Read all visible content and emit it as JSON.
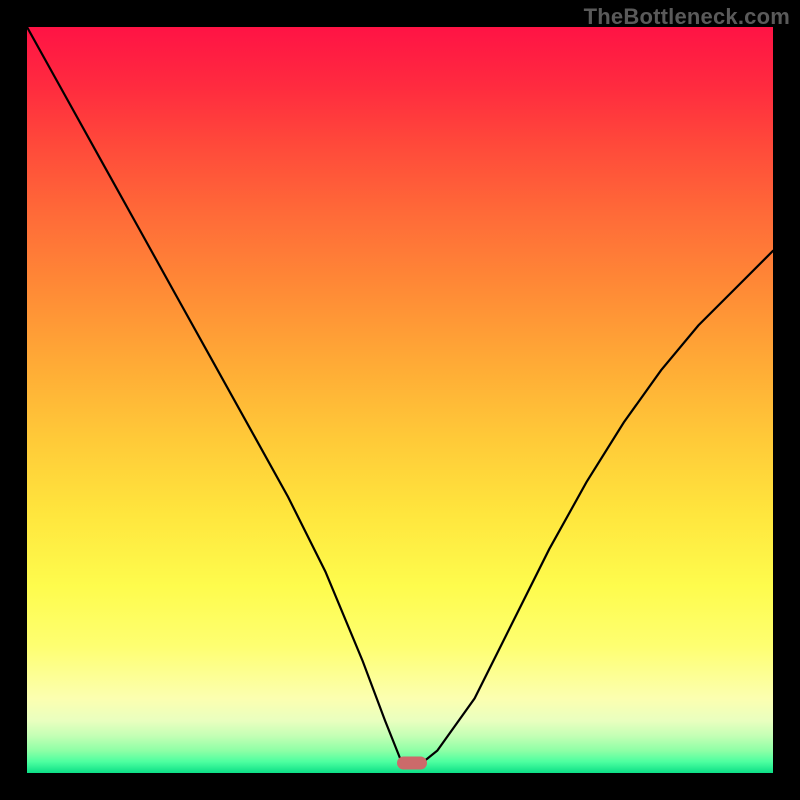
{
  "watermark": "TheBottleneck.com",
  "colors": {
    "frame_bg": "#000000",
    "watermark": "#5a5a5a",
    "curve": "#000000",
    "marker": "#cc6a6a"
  },
  "marker": {
    "x_pct": 51.6,
    "y_pct": 98.7
  },
  "chart_data": {
    "type": "line",
    "title": "",
    "xlabel": "",
    "ylabel": "",
    "xlim": [
      0,
      100
    ],
    "ylim": [
      0,
      100
    ],
    "grid": false,
    "legend": false,
    "series": [
      {
        "name": "bottleneck-curve",
        "x": [
          0,
          5,
          10,
          15,
          20,
          25,
          30,
          35,
          40,
          45,
          48,
          50,
          51.6,
          53,
          55,
          60,
          65,
          70,
          75,
          80,
          85,
          90,
          95,
          100
        ],
        "y": [
          100,
          91,
          82,
          73,
          64,
          55,
          46,
          37,
          27,
          15,
          7,
          2,
          1.3,
          1.4,
          3,
          10,
          20,
          30,
          39,
          47,
          54,
          60,
          65,
          70
        ]
      }
    ],
    "background_gradient": {
      "orientation": "vertical",
      "stops": [
        {
          "pos": 0.0,
          "color": "#ff1345"
        },
        {
          "pos": 0.25,
          "color": "#ff6a38"
        },
        {
          "pos": 0.55,
          "color": "#ffc938"
        },
        {
          "pos": 0.8,
          "color": "#feff71"
        },
        {
          "pos": 0.95,
          "color": "#c4ffb5"
        },
        {
          "pos": 1.0,
          "color": "#0cdf86"
        }
      ]
    },
    "annotations": [
      {
        "type": "marker",
        "shape": "rounded-rect",
        "x": 51.6,
        "y": 1.3,
        "color": "#cc6a6a"
      }
    ]
  }
}
